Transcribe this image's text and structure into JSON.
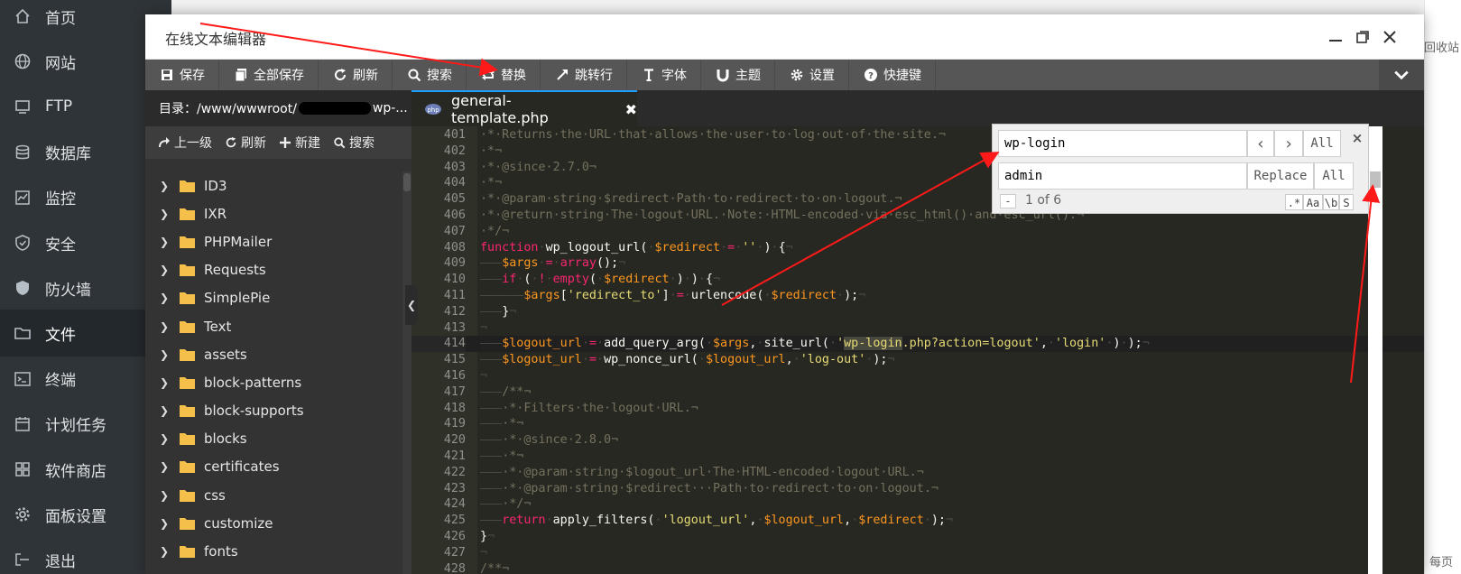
{
  "app_nav": {
    "items": [
      {
        "label": "首页",
        "icon": "home-icon"
      },
      {
        "label": "网站",
        "icon": "globe-icon"
      },
      {
        "label": "FTP",
        "icon": "ftp-icon"
      },
      {
        "label": "数据库",
        "icon": "database-icon"
      },
      {
        "label": "监控",
        "icon": "monitor-icon"
      },
      {
        "label": "安全",
        "icon": "shield-check-icon"
      },
      {
        "label": "防火墙",
        "icon": "shield-icon"
      },
      {
        "label": "文件",
        "icon": "folder-icon"
      },
      {
        "label": "终端",
        "icon": "terminal-icon"
      },
      {
        "label": "计划任务",
        "icon": "calendar-icon"
      },
      {
        "label": "软件商店",
        "icon": "grid-icon"
      },
      {
        "label": "面板设置",
        "icon": "gear-icon"
      },
      {
        "label": "退出",
        "icon": "logout-icon"
      }
    ],
    "active_index": 7
  },
  "background_page": {
    "recycle_label": "回收站",
    "per_page_label": "每页"
  },
  "modal": {
    "title": "在线文本编辑器"
  },
  "toolbar": {
    "buttons": [
      {
        "label": "保存",
        "icon": "save-icon"
      },
      {
        "label": "全部保存",
        "icon": "save-all-icon"
      },
      {
        "label": "刷新",
        "icon": "refresh-icon"
      },
      {
        "label": "搜索",
        "icon": "search-icon"
      },
      {
        "label": "替换",
        "icon": "replace-icon"
      },
      {
        "label": "跳转行",
        "icon": "goto-line-icon"
      },
      {
        "label": "字体",
        "icon": "font-icon"
      },
      {
        "label": "主题",
        "icon": "theme-icon"
      },
      {
        "label": "设置",
        "icon": "gear-icon"
      },
      {
        "label": "快捷键",
        "icon": "help-icon"
      }
    ]
  },
  "file_tree": {
    "path_prefix": "目录：/www/wwwroot/",
    "path_suffix": "wp-...",
    "actions": [
      {
        "label": "上一级",
        "icon": "up-level-icon"
      },
      {
        "label": "刷新",
        "icon": "refresh-icon"
      },
      {
        "label": "新建",
        "icon": "plus-icon"
      },
      {
        "label": "搜索",
        "icon": "search-icon"
      }
    ],
    "folders": [
      "ID3",
      "IXR",
      "PHPMailer",
      "Requests",
      "SimplePie",
      "Text",
      "assets",
      "block-patterns",
      "block-supports",
      "blocks",
      "certificates",
      "css",
      "customize",
      "fonts"
    ]
  },
  "editor": {
    "tab_label": "general-template.php",
    "active_line": 414,
    "lines": [
      {
        "n": "401",
        "html": "<span class='c-cm'>·*·Returns·the·URL·that·allows·the·user·to·log·out·of·the·site.¬</span>"
      },
      {
        "n": "402",
        "html": "<span class='c-cm'>·*¬</span>"
      },
      {
        "n": "403",
        "html": "<span class='c-cm'>·*·@since·2.7.0¬</span>"
      },
      {
        "n": "404",
        "html": "<span class='c-cm'>·*¬</span>"
      },
      {
        "n": "405",
        "html": "<span class='c-cm'>·*·@param·string·$redirect·Path·to·redirect·to·on·logout.¬</span>"
      },
      {
        "n": "406",
        "html": "<span class='c-cm'>·*·@return·string·The·logout·URL.·Note:·HTML-encoded·via·esc_html()·and·esc_url().¬</span>"
      },
      {
        "n": "407",
        "html": "<span class='c-cm'>·*/¬</span>"
      },
      {
        "n": "408",
        "html": "<span class='c-kw'>function</span><span class='c-inv'>·</span><span class='c-pl'>wp_logout_url(</span><span class='c-inv'>·</span><span class='c-var'>$redirect</span><span class='c-inv'>·</span><span class='c-kw'>=</span><span class='c-inv'>·</span><span class='c-str'>''</span><span class='c-inv'>·</span><span class='c-pl'>)</span><span class='c-inv'>·</span><span class='c-pl'>{</span><span class='c-inv'>¬</span>"
      },
      {
        "n": "409",
        "html": "<span class='c-inv'>———</span><span class='c-var'>$args</span><span class='c-inv'>·</span><span class='c-kw'>=</span><span class='c-inv'>·</span><span class='c-kw'>array</span><span class='c-pl'>();</span><span class='c-inv'>¬</span>"
      },
      {
        "n": "410",
        "html": "<span class='c-inv'>———</span><span class='c-kw'>if</span><span class='c-inv'>·</span><span class='c-pl'>(</span><span class='c-inv'>·</span><span class='c-kw'>!</span><span class='c-inv'>·</span><span class='c-kw'>empty</span><span class='c-pl'>(</span><span class='c-inv'>·</span><span class='c-var'>$redirect</span><span class='c-inv'>·</span><span class='c-pl'>)</span><span class='c-inv'>·</span><span class='c-pl'>)</span><span class='c-inv'>·</span><span class='c-pl'>{</span><span class='c-inv'>¬</span>"
      },
      {
        "n": "411",
        "html": "<span class='c-inv'>——————</span><span class='c-var'>$args</span><span class='c-pl'>[</span><span class='c-str'>'redirect_to'</span><span class='c-pl'>]</span><span class='c-inv'>·</span><span class='c-kw'>=</span><span class='c-inv'>·</span><span class='c-pl'>urlencode(</span><span class='c-inv'>·</span><span class='c-var'>$redirect</span><span class='c-inv'>·</span><span class='c-pl'>);</span><span class='c-inv'>¬</span>"
      },
      {
        "n": "412",
        "html": "<span class='c-inv'>———</span><span class='c-pl'>}</span><span class='c-inv'>¬</span>"
      },
      {
        "n": "413",
        "html": "<span class='c-inv'>¬</span>"
      },
      {
        "n": "414",
        "html": "<span class='c-inv'>———</span><span class='c-var'>$logout_url</span><span class='c-inv'>·</span><span class='c-kw'>=</span><span class='c-inv'>·</span><span class='c-pl'>add_query_arg(</span><span class='c-inv'>·</span><span class='c-var'>$args</span><span class='c-pl'>,</span><span class='c-inv'>·</span><span class='c-pl'>site_url(</span><span class='c-inv'>·</span><span class='c-str'>'<span class='c-hl'>wp-login</span>.php?action=logout'</span><span class='c-pl'>,</span><span class='c-inv'>·</span><span class='c-str'>'login'</span><span class='c-inv'>·</span><span class='c-pl'>)</span><span class='c-inv'>·</span><span class='c-pl'>);</span><span class='c-inv'>¬</span>"
      },
      {
        "n": "415",
        "html": "<span class='c-inv'>———</span><span class='c-var'>$logout_url</span><span class='c-inv'>·</span><span class='c-kw'>=</span><span class='c-inv'>·</span><span class='c-pl'>wp_nonce_url(</span><span class='c-inv'>·</span><span class='c-var'>$logout_url</span><span class='c-pl'>,</span><span class='c-inv'>·</span><span class='c-str'>'log-out'</span><span class='c-inv'>·</span><span class='c-pl'>);</span><span class='c-inv'>¬</span>"
      },
      {
        "n": "416",
        "html": "<span class='c-inv'>¬</span>"
      },
      {
        "n": "417",
        "html": "<span class='c-inv'>———</span><span class='c-cm'>/**¬</span>"
      },
      {
        "n": "418",
        "html": "<span class='c-inv'>———</span><span class='c-cm'>·*·Filters·the·logout·URL.¬</span>"
      },
      {
        "n": "419",
        "html": "<span class='c-inv'>———</span><span class='c-cm'>·*¬</span>"
      },
      {
        "n": "420",
        "html": "<span class='c-inv'>———</span><span class='c-cm'>·*·@since·2.8.0¬</span>"
      },
      {
        "n": "421",
        "html": "<span class='c-inv'>———</span><span class='c-cm'>·*¬</span>"
      },
      {
        "n": "422",
        "html": "<span class='c-inv'>———</span><span class='c-cm'>·*·@param·string·$logout_url·The·HTML-encoded·logout·URL.¬</span>"
      },
      {
        "n": "423",
        "html": "<span class='c-inv'>———</span><span class='c-cm'>·*·@param·string·$redirect···Path·to·redirect·to·on·logout.¬</span>"
      },
      {
        "n": "424",
        "html": "<span class='c-inv'>———</span><span class='c-cm'>·*/¬</span>"
      },
      {
        "n": "425",
        "html": "<span class='c-inv'>———</span><span class='c-kw'>return</span><span class='c-inv'>·</span><span class='c-pl'>apply_filters(</span><span class='c-inv'>·</span><span class='c-str'>'logout_url'</span><span class='c-pl'>,</span><span class='c-inv'>·</span><span class='c-var'>$logout_url</span><span class='c-pl'>,</span><span class='c-inv'>·</span><span class='c-var'>$redirect</span><span class='c-inv'>·</span><span class='c-pl'>);</span><span class='c-inv'>¬</span>"
      },
      {
        "n": "426",
        "html": "<span class='c-pl'>}</span><span class='c-inv'>¬</span>"
      },
      {
        "n": "427",
        "html": "<span class='c-inv'>¬</span>"
      },
      {
        "n": "428",
        "html": "<span class='c-cm'>/**¬</span>"
      }
    ]
  },
  "search_replace": {
    "find_value": "wp-login",
    "replace_value": "admin",
    "prev_icon": "‹",
    "next_icon": "›",
    "find_all_label": "All",
    "replace_label": "Replace",
    "replace_all_label": "All",
    "close_label": "×",
    "counter": "1 of 6",
    "minus_label": "-",
    "options": [
      ".*",
      "Aa",
      "\\b",
      "S"
    ]
  },
  "colors": {
    "accent": "#1e9fff",
    "annotation": "#ff1a1a",
    "editor_bg": "#272822"
  }
}
